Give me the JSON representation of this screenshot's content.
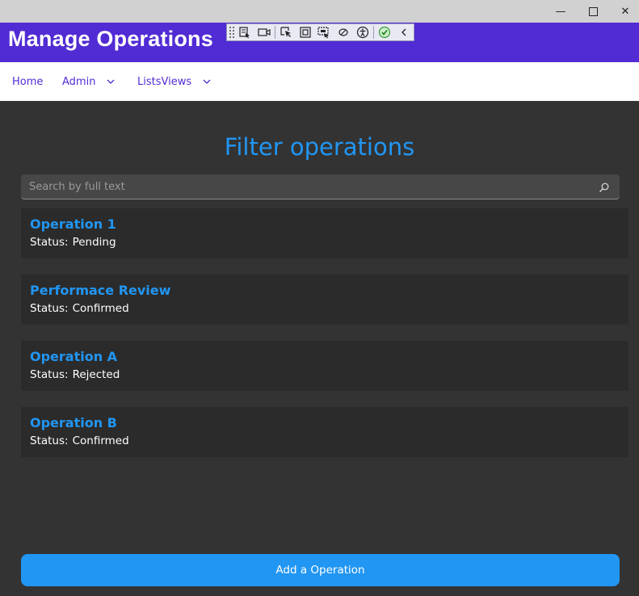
{
  "window": {
    "controls": {
      "minimize_icon": "minimize-icon",
      "maximize_icon": "maximize-icon",
      "close_icon": "close-icon",
      "minimize_glyph": "—",
      "close_glyph": "✕"
    }
  },
  "header": {
    "title": "Manage Operations",
    "background": "#512bd4"
  },
  "debug_toolbar": {
    "icons": [
      "live-visual-tree-icon",
      "record-icon",
      "select-element-icon",
      "display-layout-adorners-icon",
      "track-focus-icon",
      "binding-failures-icon",
      "accessibility-checker-icon",
      "hot-reload-ok-icon",
      "collapse-chevron-icon"
    ]
  },
  "nav": {
    "items": [
      {
        "label": "Home",
        "has_dropdown": false
      },
      {
        "label": "Admin",
        "has_dropdown": true
      },
      {
        "label": "ListsViews",
        "has_dropdown": true
      }
    ],
    "color": "#512bd4"
  },
  "main": {
    "heading": "Filter operations",
    "search": {
      "placeholder": "Search by full text",
      "value": ""
    },
    "status_label": "Status:",
    "operations": [
      {
        "name": "Operation 1",
        "status": "Pending"
      },
      {
        "name": "Performace Review",
        "status": "Confirmed"
      },
      {
        "name": "Operation A",
        "status": "Rejected"
      },
      {
        "name": "Operation B",
        "status": "Confirmed"
      }
    ],
    "add_button_label": "Add a Operation",
    "accent": "#2196f3",
    "background": "#333333",
    "card_background": "#2b2b2b"
  }
}
